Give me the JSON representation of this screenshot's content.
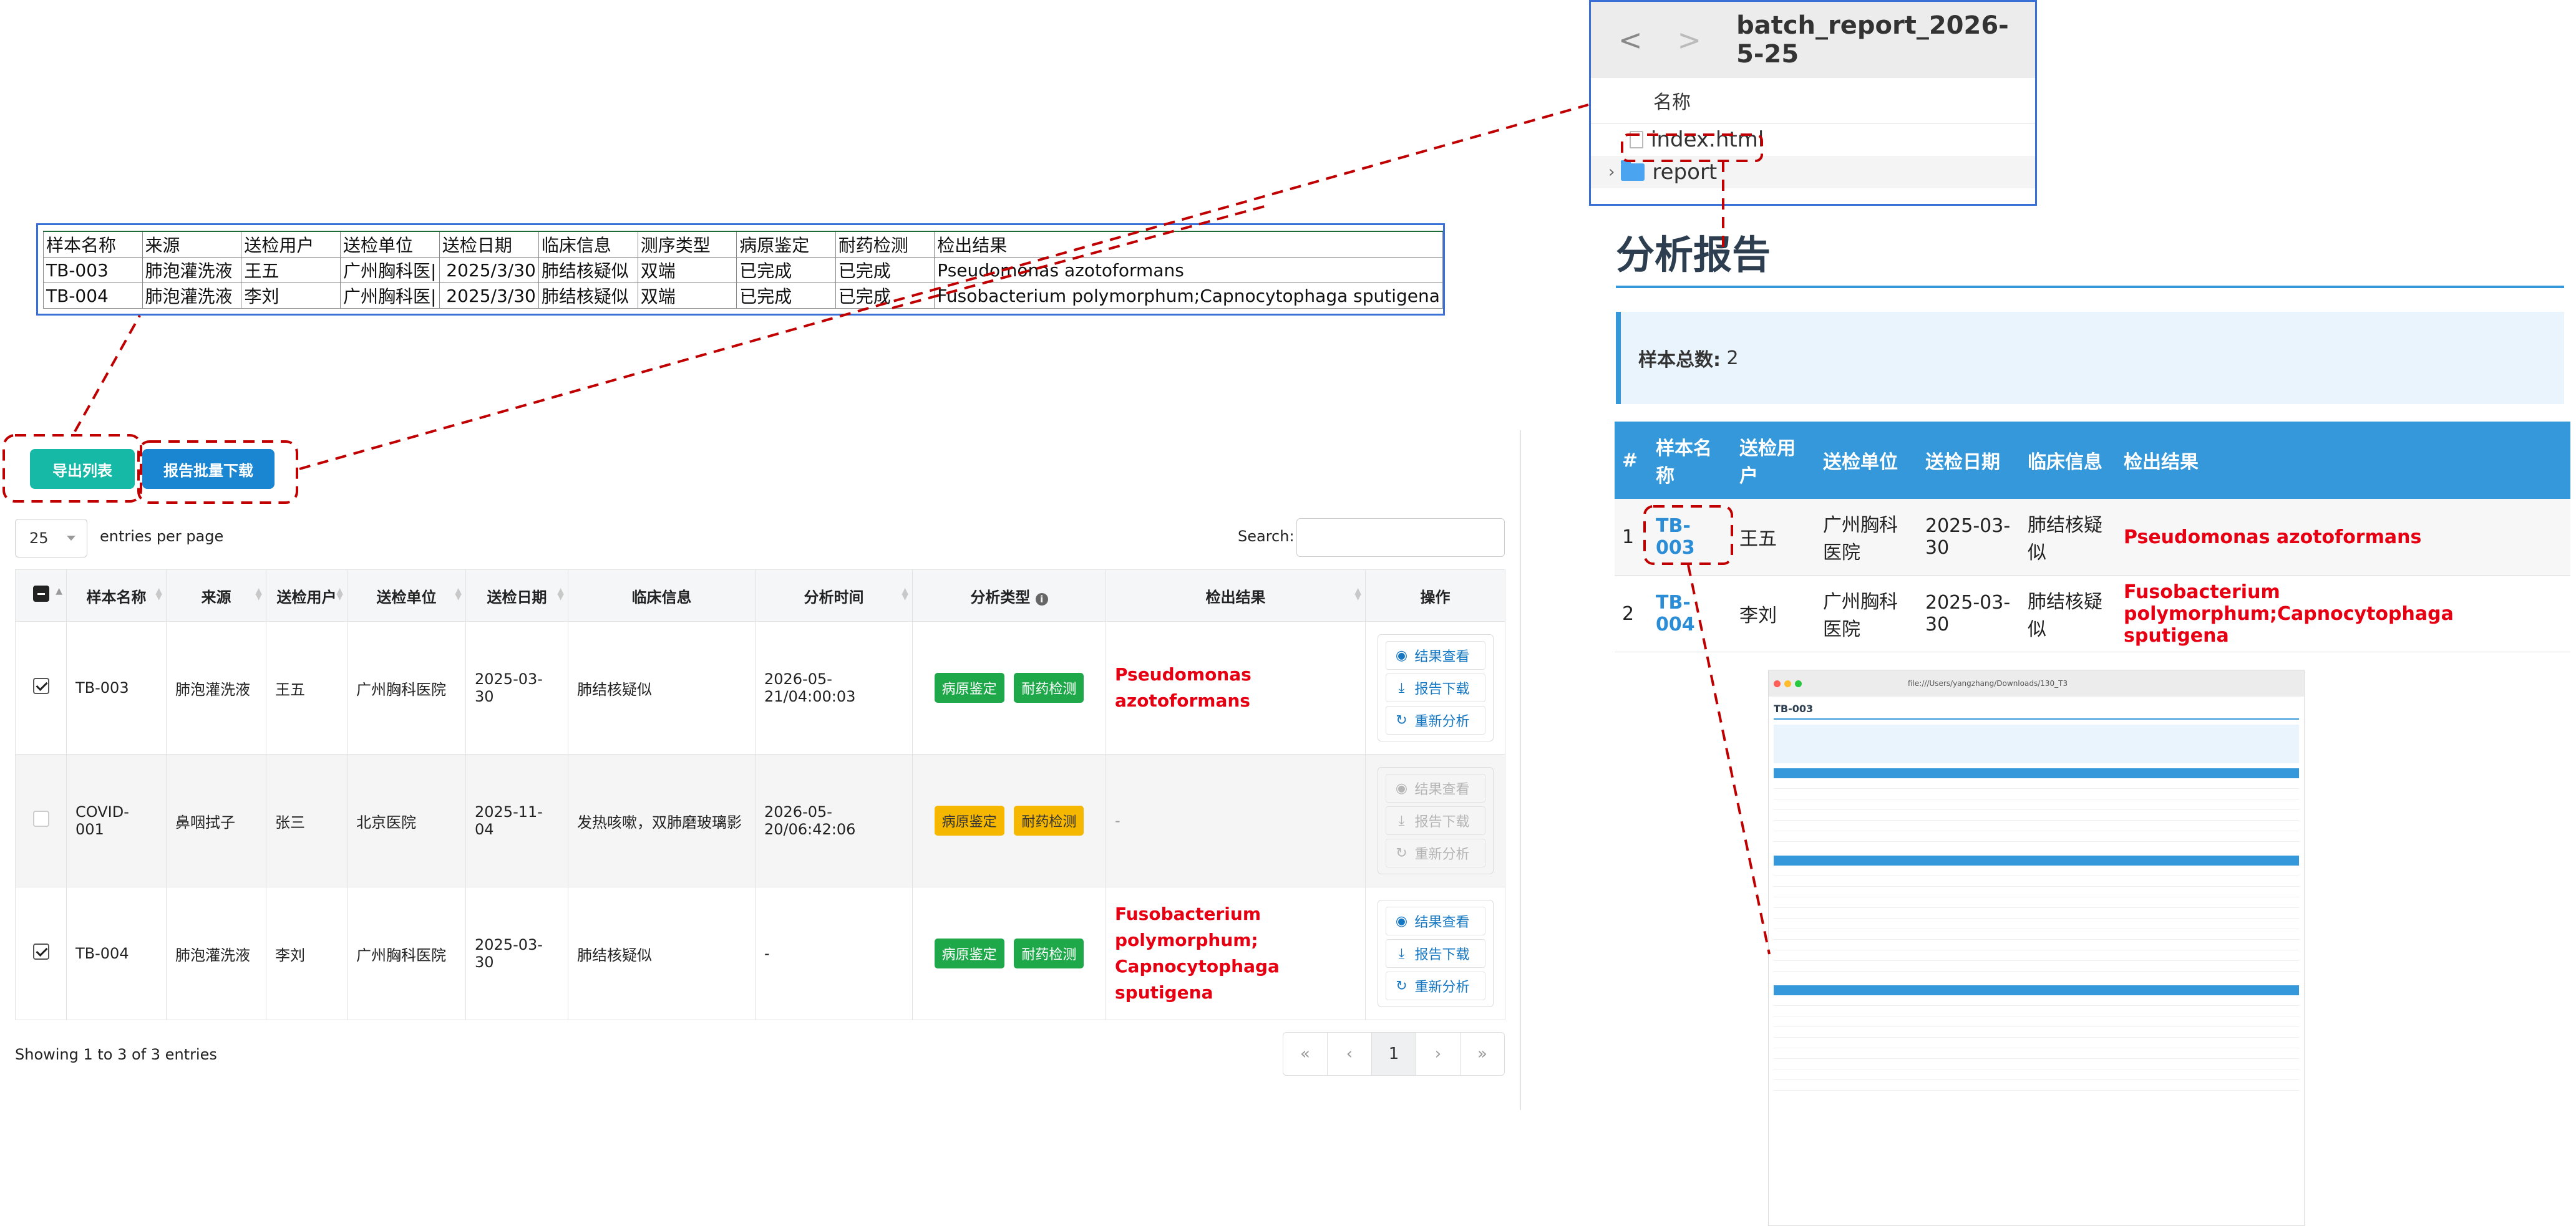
{
  "excel": {
    "headers": [
      "样本名称",
      "来源",
      "送检用户",
      "送检单位",
      "送检日期",
      "临床信息",
      "测序类型",
      "病原鉴定",
      "耐药检测",
      "检出结果"
    ],
    "rows": [
      [
        "TB-003",
        "肺泡灌洗液",
        "王五",
        "广州胸科医|",
        "2025/3/30",
        "肺结核疑似",
        "双端",
        "已完成",
        "已完成",
        "Pseudomonas azotoformans"
      ],
      [
        "TB-004",
        "肺泡灌洗液",
        "李刘",
        "广州胸科医|",
        "2025/3/30",
        "肺结核疑似",
        "双端",
        "已完成",
        "已完成",
        "Fusobacterium polymorphum;Capnocytophaga sputigena"
      ]
    ]
  },
  "toolbar": {
    "export_label": "导出列表",
    "batch_label": "报告批量下载"
  },
  "length": {
    "value": "25",
    "label": "entries per page"
  },
  "search": {
    "label": "Search:",
    "placeholder": ""
  },
  "table": {
    "headers": [
      "样本名称",
      "来源",
      "送检用户",
      "送检单位",
      "送检日期",
      "临床信息",
      "分析时间",
      "分析类型",
      "检出结果",
      "操作"
    ],
    "rows": [
      {
        "checked": true,
        "name": "TB-003",
        "source": "肺泡灌洗液",
        "user": "王五",
        "unit": "广州胸科医院",
        "date": "2025-03-30",
        "clinical": "肺结核疑似",
        "time": "2026-05-21/04:00:03",
        "types": [
          "病原鉴定",
          "耐药检测"
        ],
        "type_color": "green",
        "result": "Pseudomonas azotoformans",
        "enabled": true
      },
      {
        "checked": false,
        "name": "COVID-001",
        "source": "鼻咽拭子",
        "user": "张三",
        "unit": "北京医院",
        "date": "2025-11-04",
        "clinical": "发热咳嗽，双肺磨玻璃影",
        "time": "2026-05-20/06:42:06",
        "types": [
          "病原鉴定",
          "耐药检测"
        ],
        "type_color": "yellow",
        "result": "-",
        "enabled": false
      },
      {
        "checked": true,
        "name": "TB-004",
        "source": "肺泡灌洗液",
        "user": "李刘",
        "unit": "广州胸科医院",
        "date": "2025-03-30",
        "clinical": "肺结核疑似",
        "time": "-",
        "types": [
          "病原鉴定",
          "耐药检测"
        ],
        "type_color": "green",
        "result": "Fusobacterium polymorphum; Capnocytophaga sputigena",
        "enabled": true
      }
    ],
    "actions": [
      "结果查看",
      "报告下载",
      "重新分析"
    ]
  },
  "footer": {
    "info": "Showing 1 to 3 of 3 entries",
    "pager": [
      "«",
      "‹",
      "1",
      "›",
      "»"
    ]
  },
  "finder": {
    "title": "batch_report_2026-5-25",
    "column": "名称",
    "items": [
      "index.html",
      "report"
    ]
  },
  "report": {
    "title": "分析报告",
    "summary_label": "样本总数:",
    "summary_value": "2",
    "headers": [
      "#",
      "样本名称",
      "送检用户",
      "送检单位",
      "送检日期",
      "临床信息",
      "检出结果"
    ],
    "rows": [
      [
        "1",
        "TB-003",
        "王五",
        "广州胸科医院",
        "2025-03-30",
        "肺结核疑似",
        "Pseudomonas azotoformans"
      ],
      [
        "2",
        "TB-004",
        "李刘",
        "广州胸科医院",
        "2025-03-30",
        "肺结核疑似",
        "Fusobacterium polymorphum;Capnocytophaga sputigena"
      ]
    ]
  },
  "mini": {
    "url": "file:///Users/yangzhang/Downloads/130_T3",
    "title": "TB-003"
  },
  "colors": {
    "annotation": "#c00000",
    "primary": "#1a85d0",
    "teal": "#16b8a6",
    "red_text": "#e60012"
  }
}
